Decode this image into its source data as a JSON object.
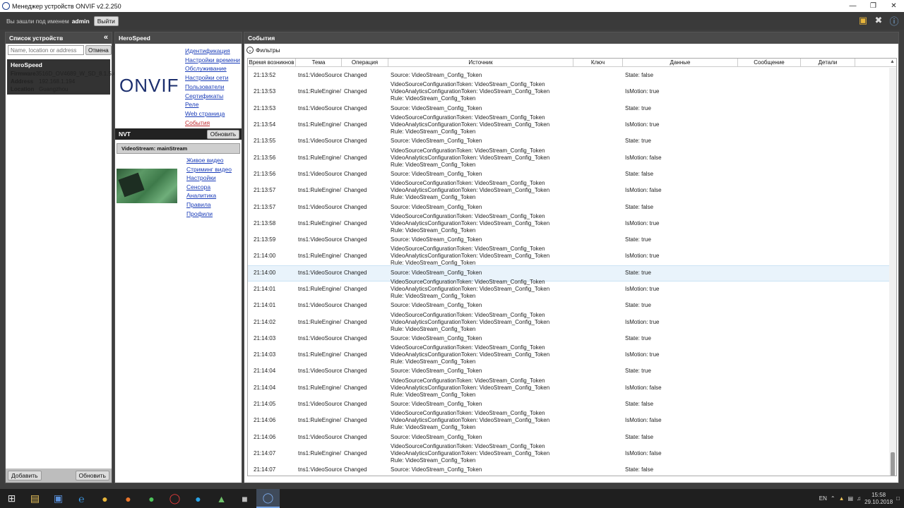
{
  "window": {
    "title": "Менеджер устройств ONVIF v2.2.250",
    "controls": [
      "minimize-icon",
      "restore-icon",
      "close-icon"
    ]
  },
  "topbar": {
    "logged_in_label": "Вы зашли под именем",
    "username": "admin",
    "logout_label": "Выйти"
  },
  "devices_panel": {
    "title": "Список устройств",
    "collapse_glyph": "«",
    "search_placeholder": "Name, location or address",
    "cancel_label": "Отмена",
    "device": {
      "name": "HeroSpeed",
      "firmware_label": "Firmware",
      "firmware": "3516D_OV4689_W_SD_8.1.5.4",
      "address_label": "Address",
      "address": "192.168.1.194",
      "location_label": "Location",
      "location": "Guangzhou"
    },
    "add_label": "Добавить",
    "refresh_label": "Обновить"
  },
  "device_panel": {
    "title": "HeroSpeed",
    "logo_text": "ONVIF",
    "links": [
      {
        "label": "Идентификация"
      },
      {
        "label": "Настройки времени"
      },
      {
        "label": "Обслуживание"
      },
      {
        "label": "Настройки сети"
      },
      {
        "label": "Пользователи"
      },
      {
        "label": "Сертификаты"
      },
      {
        "label": "Реле"
      },
      {
        "label": "Web страница"
      },
      {
        "label": "События"
      }
    ],
    "nvt_label": "NVT",
    "nvt_refresh_label": "Обновить",
    "stream_label": "VideoStream: mainStream",
    "stream_links": [
      {
        "label": "Живое видео"
      },
      {
        "label": "Стриминг видео"
      },
      {
        "label": "Настройки Сенсора"
      },
      {
        "label": "Аналитика"
      },
      {
        "label": "Правила"
      },
      {
        "label": "Профили"
      }
    ]
  },
  "events_panel": {
    "title": "События",
    "filters_label": "Фильтры",
    "columns": [
      "Время возникнов",
      "Тема",
      "Операция",
      "Источник",
      "Ключ",
      "Данные",
      "Сообщение",
      "Детали"
    ],
    "rows": [
      {
        "time": "21:13:52",
        "topic": "tns1:VideoSource",
        "op": "Changed",
        "src": [
          "Source: VideoStream_Config_Token"
        ],
        "data": "State: false"
      },
      {
        "time": "21:13:53",
        "topic": "tns1:RuleEngine/",
        "op": "Changed",
        "src": [
          "VideoSourceConfigurationToken: VideoStream_Config_Token",
          "VideoAnalyticsConfigurationToken: VideoStream_Config_Token",
          "Rule: VideoStream_Config_Token"
        ],
        "data": "IsMotion: true"
      },
      {
        "time": "21:13:53",
        "topic": "tns1:VideoSource",
        "op": "Changed",
        "src": [
          "Source: VideoStream_Config_Token"
        ],
        "data": "State: true"
      },
      {
        "time": "21:13:54",
        "topic": "tns1:RuleEngine/",
        "op": "Changed",
        "src": [
          "VideoSourceConfigurationToken: VideoStream_Config_Token",
          "VideoAnalyticsConfigurationToken: VideoStream_Config_Token",
          "Rule: VideoStream_Config_Token"
        ],
        "data": "IsMotion: true"
      },
      {
        "time": "21:13:55",
        "topic": "tns1:VideoSource",
        "op": "Changed",
        "src": [
          "Source: VideoStream_Config_Token"
        ],
        "data": "State: true"
      },
      {
        "time": "21:13:56",
        "topic": "tns1:RuleEngine/",
        "op": "Changed",
        "src": [
          "VideoSourceConfigurationToken: VideoStream_Config_Token",
          "VideoAnalyticsConfigurationToken: VideoStream_Config_Token",
          "Rule: VideoStream_Config_Token"
        ],
        "data": "IsMotion: false"
      },
      {
        "time": "21:13:56",
        "topic": "tns1:VideoSource",
        "op": "Changed",
        "src": [
          "Source: VideoStream_Config_Token"
        ],
        "data": "State: false"
      },
      {
        "time": "21:13:57",
        "topic": "tns1:RuleEngine/",
        "op": "Changed",
        "src": [
          "VideoSourceConfigurationToken: VideoStream_Config_Token",
          "VideoAnalyticsConfigurationToken: VideoStream_Config_Token",
          "Rule: VideoStream_Config_Token"
        ],
        "data": "IsMotion: false"
      },
      {
        "time": "21:13:57",
        "topic": "tns1:VideoSource",
        "op": "Changed",
        "src": [
          "Source: VideoStream_Config_Token"
        ],
        "data": "State: false"
      },
      {
        "time": "21:13:58",
        "topic": "tns1:RuleEngine/",
        "op": "Changed",
        "src": [
          "VideoSourceConfigurationToken: VideoStream_Config_Token",
          "VideoAnalyticsConfigurationToken: VideoStream_Config_Token",
          "Rule: VideoStream_Config_Token"
        ],
        "data": "IsMotion: true"
      },
      {
        "time": "21:13:59",
        "topic": "tns1:VideoSource",
        "op": "Changed",
        "src": [
          "Source: VideoStream_Config_Token"
        ],
        "data": "State: true"
      },
      {
        "time": "21:14:00",
        "topic": "tns1:RuleEngine/",
        "op": "Changed",
        "src": [
          "VideoSourceConfigurationToken: VideoStream_Config_Token",
          "VideoAnalyticsConfigurationToken: VideoStream_Config_Token",
          "Rule: VideoStream_Config_Token"
        ],
        "data": "IsMotion: true"
      },
      {
        "time": "21:14:00",
        "topic": "tns1:VideoSource",
        "op": "Changed",
        "src": [
          "Source: VideoStream_Config_Token"
        ],
        "data": "State: true",
        "selected": true
      },
      {
        "time": "21:14:01",
        "topic": "tns1:RuleEngine/",
        "op": "Changed",
        "src": [
          "VideoSourceConfigurationToken: VideoStream_Config_Token",
          "VideoAnalyticsConfigurationToken: VideoStream_Config_Token",
          "Rule: VideoStream_Config_Token"
        ],
        "data": "IsMotion: true"
      },
      {
        "time": "21:14:01",
        "topic": "tns1:VideoSource",
        "op": "Changed",
        "src": [
          "Source: VideoStream_Config_Token"
        ],
        "data": "State: true"
      },
      {
        "time": "21:14:02",
        "topic": "tns1:RuleEngine/",
        "op": "Changed",
        "src": [
          "VideoSourceConfigurationToken: VideoStream_Config_Token",
          "VideoAnalyticsConfigurationToken: VideoStream_Config_Token",
          "Rule: VideoStream_Config_Token"
        ],
        "data": "IsMotion: true"
      },
      {
        "time": "21:14:03",
        "topic": "tns1:VideoSource",
        "op": "Changed",
        "src": [
          "Source: VideoStream_Config_Token"
        ],
        "data": "State: true"
      },
      {
        "time": "21:14:03",
        "topic": "tns1:RuleEngine/",
        "op": "Changed",
        "src": [
          "VideoSourceConfigurationToken: VideoStream_Config_Token",
          "VideoAnalyticsConfigurationToken: VideoStream_Config_Token",
          "Rule: VideoStream_Config_Token"
        ],
        "data": "IsMotion: true"
      },
      {
        "time": "21:14:04",
        "topic": "tns1:VideoSource",
        "op": "Changed",
        "src": [
          "Source: VideoStream_Config_Token"
        ],
        "data": "State: true"
      },
      {
        "time": "21:14:04",
        "topic": "tns1:RuleEngine/",
        "op": "Changed",
        "src": [
          "VideoSourceConfigurationToken: VideoStream_Config_Token",
          "VideoAnalyticsConfigurationToken: VideoStream_Config_Token",
          "Rule: VideoStream_Config_Token"
        ],
        "data": "IsMotion: false"
      },
      {
        "time": "21:14:05",
        "topic": "tns1:VideoSource",
        "op": "Changed",
        "src": [
          "Source: VideoStream_Config_Token"
        ],
        "data": "State: false"
      },
      {
        "time": "21:14:06",
        "topic": "tns1:RuleEngine/",
        "op": "Changed",
        "src": [
          "VideoSourceConfigurationToken: VideoStream_Config_Token",
          "VideoAnalyticsConfigurationToken: VideoStream_Config_Token",
          "Rule: VideoStream_Config_Token"
        ],
        "data": "IsMotion: false"
      },
      {
        "time": "21:14:06",
        "topic": "tns1:VideoSource",
        "op": "Changed",
        "src": [
          "Source: VideoStream_Config_Token"
        ],
        "data": "State: false"
      },
      {
        "time": "21:14:07",
        "topic": "tns1:RuleEngine/",
        "op": "Changed",
        "src": [
          "VideoSourceConfigurationToken: VideoStream_Config_Token",
          "VideoAnalyticsConfigurationToken: VideoStream_Config_Token",
          "Rule: VideoStream_Config_Token"
        ],
        "data": "IsMotion: false"
      },
      {
        "time": "21:14:07",
        "topic": "tns1:VideoSource",
        "op": "Changed",
        "src": [
          "Source: VideoStream_Config_Token"
        ],
        "data": "State: false"
      }
    ]
  },
  "taskbar": {
    "apps": [
      "windows-start-icon",
      "file-explorer-icon",
      "save-icon",
      "internet-explorer-icon",
      "chrome-icon",
      "firefox-icon",
      "whatsapp-icon",
      "opera-icon",
      "skype-icon",
      "installer-icon",
      "media-icon",
      "onvif-manager-icon"
    ],
    "language": "EN",
    "time": "15:58",
    "date": "29.10.2018"
  },
  "colors": {
    "accent_link": "#1a3cb8",
    "active_link": "#c0282d",
    "dark_header": "#4a4a4a",
    "selected_row": "#e9f3fb"
  }
}
